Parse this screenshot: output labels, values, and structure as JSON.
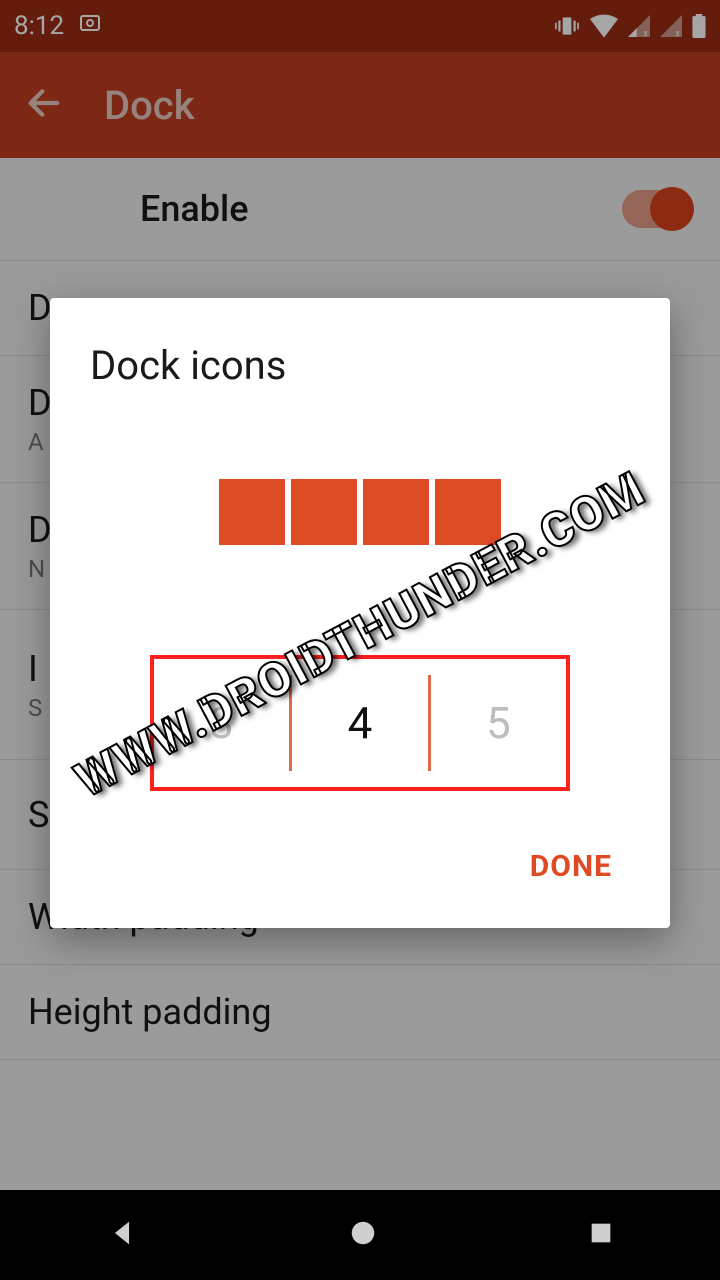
{
  "status": {
    "time": "8:12"
  },
  "appbar": {
    "title": "Dock"
  },
  "settings": {
    "enable_label": "Enable",
    "row1_label": "D",
    "row2_label": "D",
    "row2_sub": "A",
    "row3_label": "D",
    "row3_sub": "N",
    "row4_label": "I",
    "row4_sub": "S",
    "row5_label": "S",
    "row6_label": "Width padding",
    "row7_label": "Height padding"
  },
  "dialog": {
    "title": "Dock icons",
    "options": [
      "3",
      "4",
      "5"
    ],
    "selected": "4",
    "done_label": "DONE",
    "preview_count": 4
  },
  "watermark": "WWW.DROIDTHUNDER.COM",
  "colors": {
    "accent": "#dd4b25",
    "appbar": "#c03e1f",
    "statusbar": "#9a2c15"
  }
}
